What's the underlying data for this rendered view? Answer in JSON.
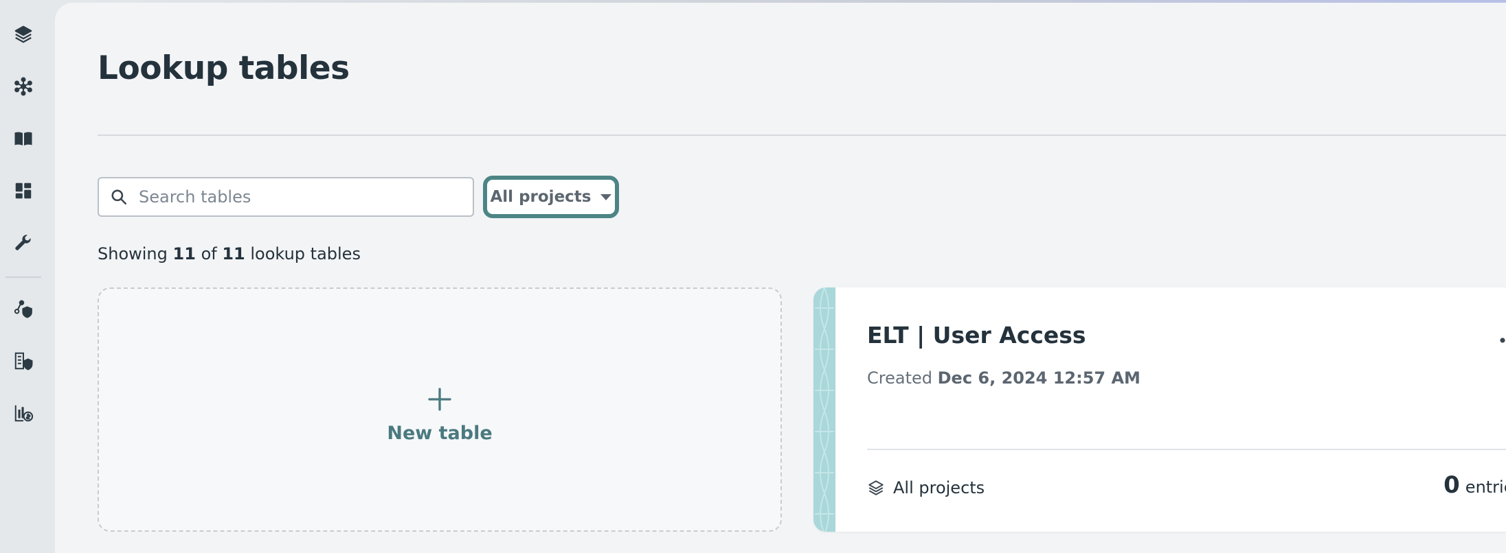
{
  "sidebar": {
    "items": [
      {
        "name": "projects",
        "icon": "layers-icon"
      },
      {
        "name": "connectors",
        "icon": "network-icon"
      },
      {
        "name": "docs",
        "icon": "book-icon"
      },
      {
        "name": "dashboards",
        "icon": "dashboard-icon"
      },
      {
        "name": "tools",
        "icon": "wrench-icon"
      },
      {
        "name": "environments",
        "icon": "shared-shield-icon"
      },
      {
        "name": "workspace-admin",
        "icon": "building-shield-icon"
      },
      {
        "name": "usage",
        "icon": "billing-icon"
      }
    ]
  },
  "page": {
    "title": "Lookup tables"
  },
  "filters": {
    "search_placeholder": "Search tables",
    "search_value": "",
    "project_select": "All projects"
  },
  "summary": {
    "prefix": "Showing",
    "shown": "11",
    "of": "of",
    "total": "11",
    "suffix": "lookup tables"
  },
  "new_table": {
    "label": "New table"
  },
  "tables": [
    {
      "name": "ELT | User Access",
      "created_prefix": "Created",
      "created_at": "Dec 6, 2024 12:57 AM",
      "project": "All projects",
      "entries": "0",
      "entries_label": "entries"
    }
  ],
  "colors": {
    "accent": "#4d8585",
    "stripe": "#a9d7da",
    "text": "#24323c"
  }
}
